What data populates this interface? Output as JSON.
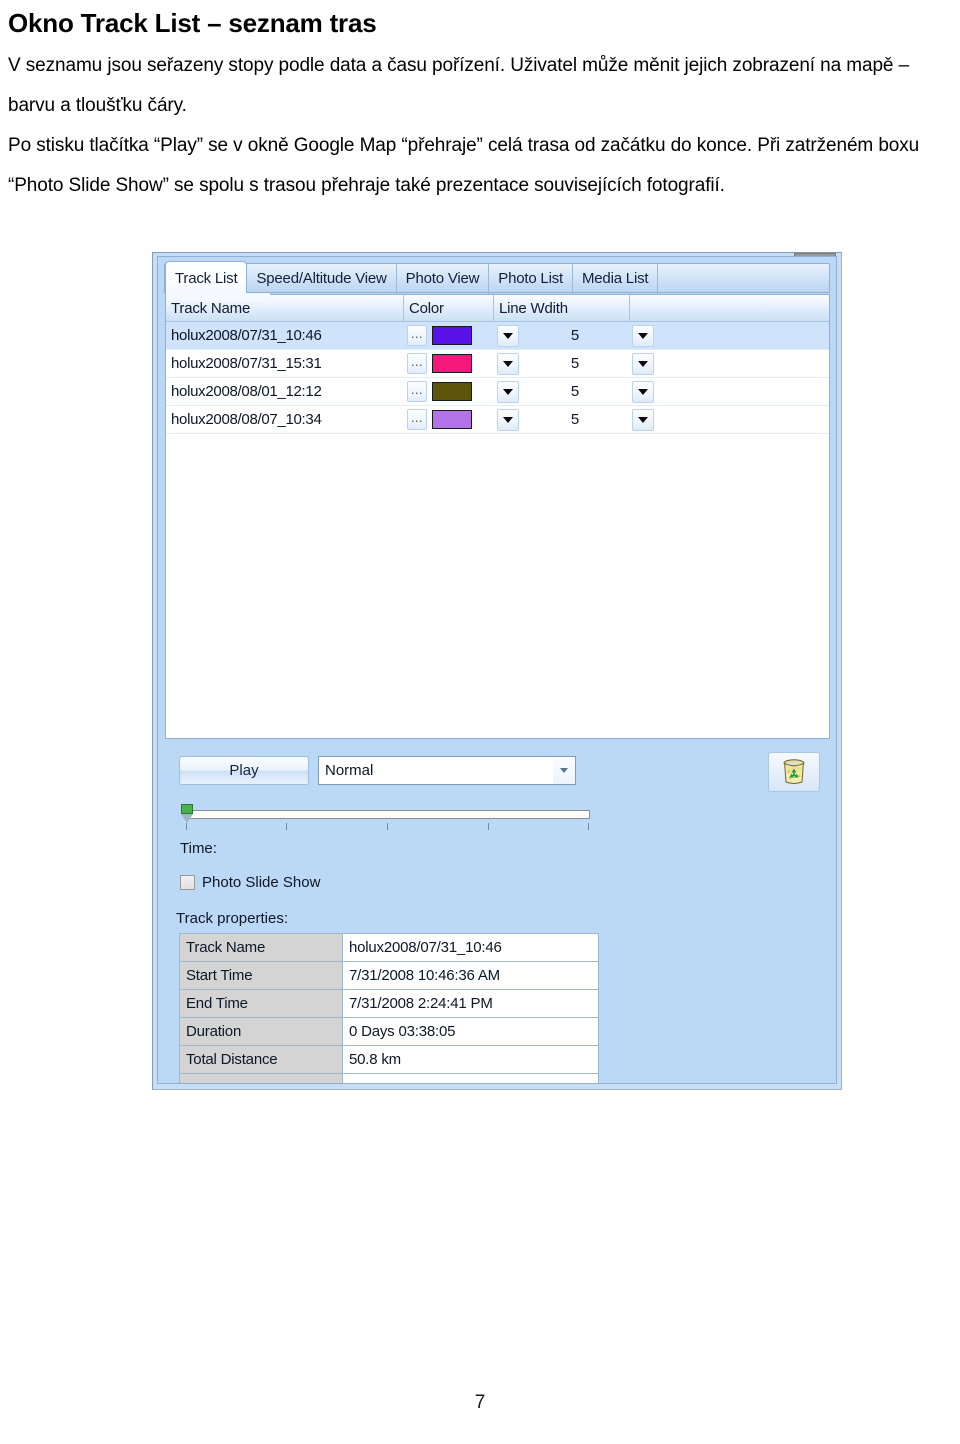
{
  "document": {
    "title": "Okno Track List – seznam tras",
    "paragraphs": [
      "V seznamu jsou seřazeny stopy podle data a času pořízení. Uživatel může měnit jejich zobrazení na mapě – barvu a tloušťku čáry.",
      "Po stisku tlačítka “Play” se v okně Google Map “přehraje” celá trasa od začátku do konce. Při zatrženém boxu “Photo Slide Show” se spolu s trasou přehraje také prezentace souvisejících fotografií."
    ],
    "page_number": "7"
  },
  "app": {
    "tabs": [
      {
        "label": "Track List",
        "active": true
      },
      {
        "label": "Speed/Altitude View",
        "active": false
      },
      {
        "label": "Photo View",
        "active": false
      },
      {
        "label": "Photo List",
        "active": false
      },
      {
        "label": "Media List",
        "active": false
      }
    ],
    "track_grid": {
      "columns": [
        "Track Name",
        "Color",
        "Line Wdith",
        ""
      ],
      "rows": [
        {
          "name": "holux2008/07/31_10:46",
          "color": "#5712e8",
          "width": "5",
          "dots": "⋯",
          "selected": true
        },
        {
          "name": "holux2008/07/31_15:31",
          "color": "#f6187c",
          "width": "5",
          "dots": "⋯",
          "selected": false
        },
        {
          "name": "holux2008/08/01_12:12",
          "color": "#5d5509",
          "width": "5",
          "dots": "⋯",
          "selected": false
        },
        {
          "name": "holux2008/08/07_10:34",
          "color": "#b272e8",
          "width": "5",
          "dots": "⋯",
          "selected": false
        }
      ]
    },
    "controls": {
      "play_label": "Play",
      "speed_value": "Normal",
      "trash_icon": "recycle-bin-icon",
      "slider_value": 0,
      "slider_ticks": 5,
      "time_label": "Time:",
      "photo_slide_show_label": "Photo Slide Show",
      "photo_slide_show_checked": false
    },
    "properties": {
      "heading": "Track properties:",
      "rows": [
        {
          "key": "Track Name",
          "value": "holux2008/07/31_10:46"
        },
        {
          "key": "Start Time",
          "value": "7/31/2008 10:46:36 AM"
        },
        {
          "key": "End Time",
          "value": "7/31/2008 2:24:41 PM"
        },
        {
          "key": "Duration",
          "value": "0 Days  03:38:05"
        },
        {
          "key": "Total Distance",
          "value": "50.8 km"
        },
        {
          "key": "",
          "value": ""
        }
      ]
    }
  },
  "colors": {
    "window_chrome": "#bcd8f7",
    "tab_active": "#ffffff",
    "grid_selection": "#cfe3fb",
    "slider_thumb": "#49b24b"
  }
}
